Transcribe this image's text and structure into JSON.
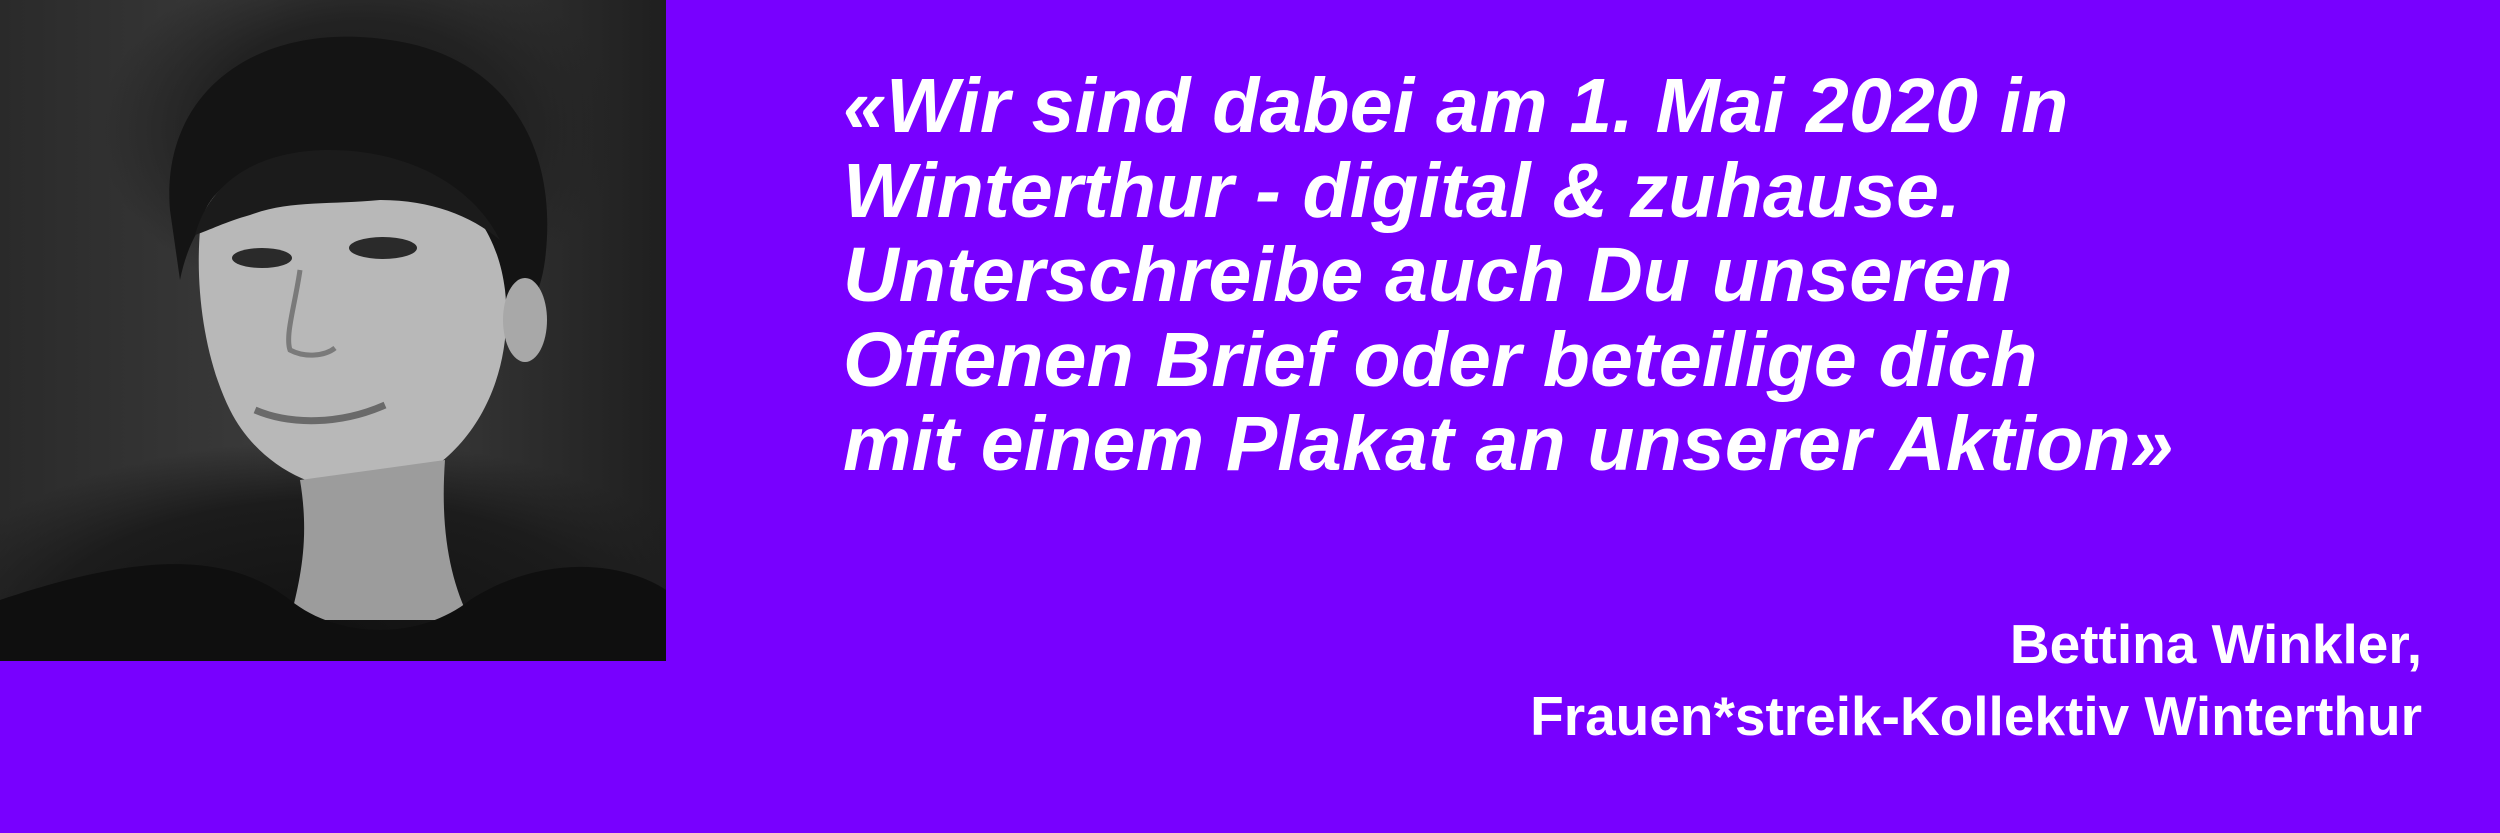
{
  "photo": {
    "icon": "portrait-photo-icon"
  },
  "quote": {
    "lines": [
      "«Wir sind dabei am 1. Mai 2020 in",
      "Winterthur - digital & zuhause.",
      "Unterschreibe auch Du unseren",
      "Offenen Brief oder beteilige dich",
      "mit einem Plakat an unserer Aktion»"
    ]
  },
  "attribution": {
    "name": "Bettina Winkler,",
    "organization": "Frauen*streik-Kollektiv Winterthur"
  },
  "colors": {
    "background": "#7800ff",
    "text": "#ffffff"
  }
}
